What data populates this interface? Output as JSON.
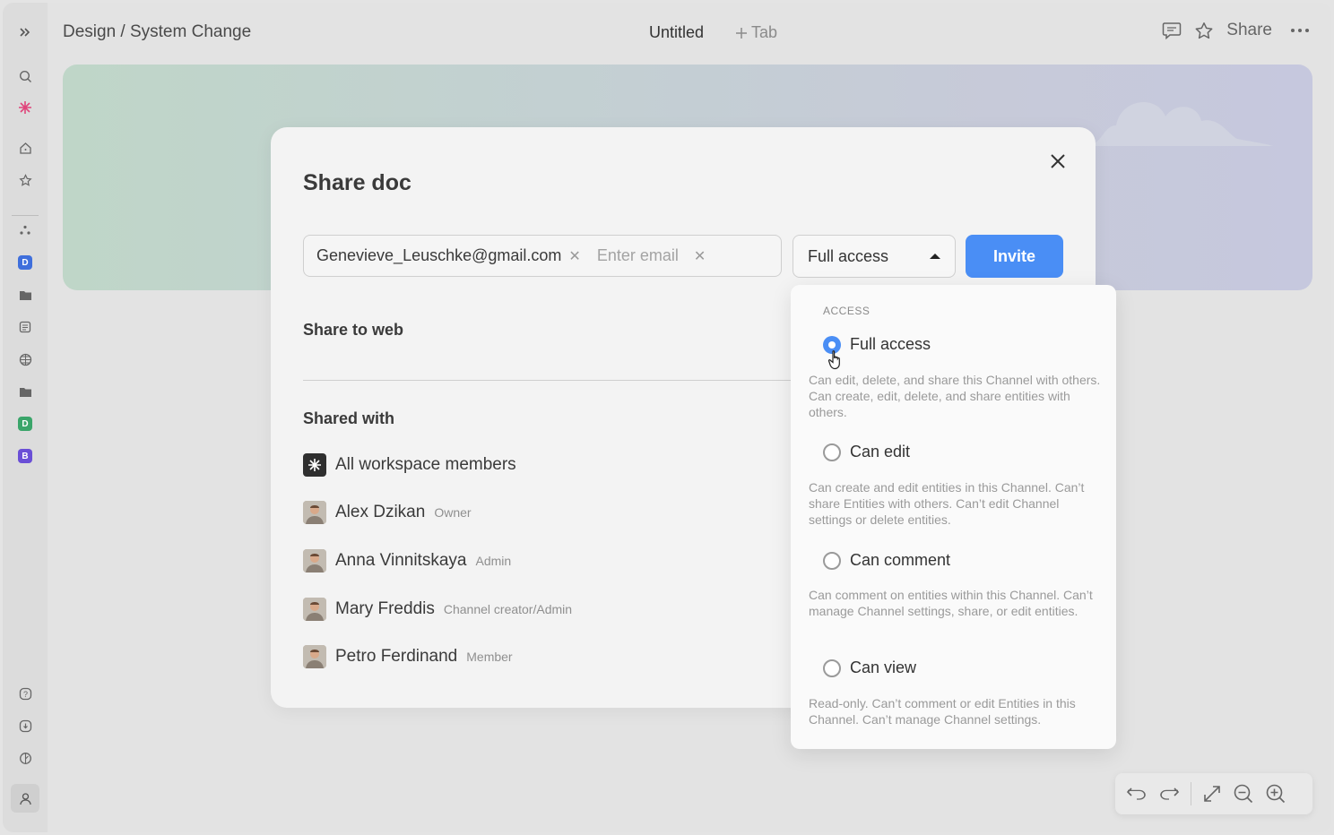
{
  "app": {
    "breadcrumb": "Design / System Change",
    "tab_title": "Untitled",
    "add_tab_label": "Tab",
    "share_label": "Share"
  },
  "sidebar": {
    "letters": [
      {
        "letter": "D",
        "color": "#3f6fdc"
      },
      {
        "letter": "D",
        "color": "#3aa56a"
      },
      {
        "letter": "B",
        "color": "#6a4fd6"
      }
    ]
  },
  "dialog": {
    "title": "Share doc",
    "email_chip": "Genevieve_Leuschke@gmail.com",
    "email_placeholder": "Enter email",
    "access_value": "Full access",
    "invite_label": "Invite",
    "share_to_web": "Share to web",
    "shared_with": "Shared with",
    "members": [
      {
        "name": "All workspace members",
        "role": ""
      },
      {
        "name": "Alex Dzikan",
        "role": "Owner"
      },
      {
        "name": "Anna Vinnitskaya",
        "role": "Admin"
      },
      {
        "name": "Mary Freddis",
        "role": "Channel creator/Admin"
      },
      {
        "name": "Petro Ferdinand",
        "role": "Member"
      }
    ]
  },
  "dropdown": {
    "header": "ACCESS",
    "options": [
      {
        "label": "Full access",
        "selected": true,
        "description": "Can edit, delete, and share this Channel with others. Can create, edit, delete, and share entities with others."
      },
      {
        "label": "Can edit",
        "selected": false,
        "description": "Can create and edit entities in this Channel. Can’t share Entities with others. Can’t edit Channel settings or delete entities."
      },
      {
        "label": "Can comment",
        "selected": false,
        "description": "Can comment on entities within this Channel. Can’t manage Channel settings, share, or edit entities."
      },
      {
        "label": "Can view",
        "selected": false,
        "description": "Read-only. Can’t comment or edit Entities in this Channel. Can’t manage Channel settings."
      }
    ]
  },
  "colors": {
    "accent": "#4a8ef5",
    "background": "#e3e3e3"
  }
}
